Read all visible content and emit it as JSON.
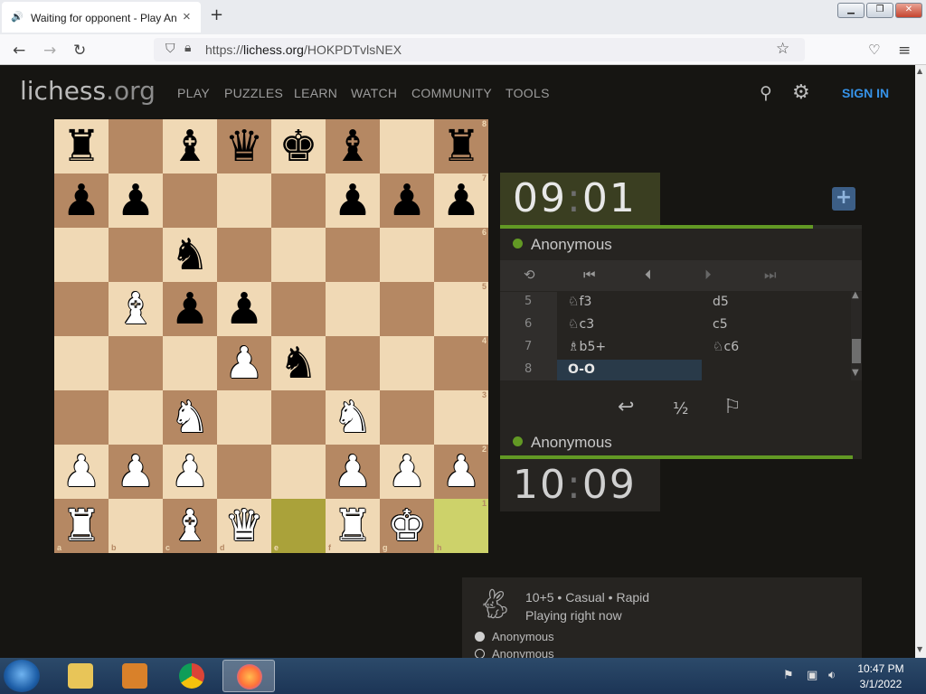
{
  "browser": {
    "tab_title": "Waiting for opponent - Play An",
    "url_prefix": "https://",
    "url_host": "lichess.org",
    "url_path": "/HOKPDTvlsNEX"
  },
  "site": {
    "logo_main": "lichess",
    "logo_tld": ".org",
    "nav": [
      "PLAY",
      "PUZZLES",
      "LEARN",
      "WATCH",
      "COMMUNITY",
      "TOOLS"
    ],
    "signin": "SIGN IN"
  },
  "board": {
    "ranks": [
      "8",
      "7",
      "6",
      "5",
      "4",
      "3",
      "2",
      "1"
    ],
    "files": [
      "a",
      "b",
      "c",
      "d",
      "e",
      "f",
      "g",
      "h"
    ],
    "position": [
      [
        "b:rook",
        "",
        "b:bishop",
        "b:queen",
        "b:king",
        "b:bishop",
        "",
        "b:rook"
      ],
      [
        "b:pawn",
        "b:pawn",
        "",
        "",
        "",
        "b:pawn",
        "b:pawn",
        "b:pawn"
      ],
      [
        "",
        "",
        "b:knight",
        "",
        "",
        "",
        "",
        ""
      ],
      [
        "",
        "w:bishop",
        "b:pawn",
        "b:pawn",
        "",
        "",
        "",
        ""
      ],
      [
        "",
        "",
        "",
        "w:pawn",
        "b:knight",
        "",
        "",
        ""
      ],
      [
        "",
        "",
        "w:knight",
        "",
        "",
        "w:knight",
        "",
        ""
      ],
      [
        "w:pawn",
        "w:pawn",
        "w:pawn",
        "",
        "",
        "w:pawn",
        "w:pawn",
        "w:pawn"
      ],
      [
        "w:rook",
        "",
        "w:bishop",
        "w:queen",
        "",
        "w:rook",
        "w:king",
        ""
      ]
    ],
    "last_move": [
      "e1",
      "h1"
    ]
  },
  "game": {
    "opponent_clock_min": "09",
    "opponent_clock_sec": "01",
    "player_clock_min": "10",
    "player_clock_sec": "09",
    "top_player": "Anonymous",
    "bottom_player": "Anonymous",
    "moves": [
      {
        "num": "5",
        "white": "♘f3",
        "black": "d5"
      },
      {
        "num": "6",
        "white": "♘c3",
        "black": "c5"
      },
      {
        "num": "7",
        "white": "♗b5+",
        "black": "♘c6"
      },
      {
        "num": "8",
        "white": "O-O",
        "black": ""
      }
    ],
    "draw_label": "½"
  },
  "game_card": {
    "type": "10+5 • Casual • Rapid",
    "status": "Playing right now",
    "player1": "Anonymous",
    "player2": "Anonymous"
  },
  "taskbar": {
    "time": "10:47 PM",
    "date": "3/1/2022"
  },
  "colors": {
    "board_light": "#f0d9b5",
    "board_dark": "#b58863",
    "accent_green": "#629924",
    "signin_blue": "#3692e7"
  }
}
